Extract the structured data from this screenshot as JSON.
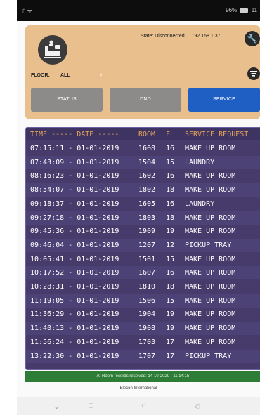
{
  "statusbar": {
    "left_icons": "▯ ᯤ",
    "battery": "96%",
    "time": "11"
  },
  "header": {
    "state_label": "State: Disconnected",
    "ip": "192.168.1.37",
    "floor_label": "FLOOR:",
    "floor_value": "ALL",
    "floor_caret": "▾"
  },
  "buttons": {
    "status": "STATUS",
    "dnd": "DND",
    "service": "SERVICE"
  },
  "colors": {
    "panel": "#e8bf8d",
    "active_button": "#1f5fc4",
    "inactive_button": "#8c8b8a",
    "table_bg": "#463b6a",
    "header_text": "#e8a25a",
    "footer_green": "#2d7d37"
  },
  "icons": {
    "logo": "hotel-room-icon",
    "settings": "wrench-icon",
    "filter": "filter-icon",
    "nav_back": "triangle-back-icon",
    "nav_home": "circle-home-icon",
    "nav_recent": "square-recent-icon",
    "nav_down": "chevron-down-icon"
  },
  "table": {
    "headers": {
      "time_date": "TIME ----- DATE -----",
      "room": "ROOM",
      "fl": "FL",
      "request": "SERVICE REQUEST"
    },
    "rows": [
      {
        "time_date": "07:15:11 - 01-01-2019",
        "room": "1608",
        "fl": "16",
        "request": "MAKE UP ROOM"
      },
      {
        "time_date": "07:43:09 - 01-01-2019",
        "room": "1504",
        "fl": "15",
        "request": "LAUNDRY"
      },
      {
        "time_date": "08:16:23 - 01-01-2019",
        "room": "1602",
        "fl": "16",
        "request": "MAKE UP ROOM"
      },
      {
        "time_date": "08:54:07 - 01-01-2019",
        "room": "1802",
        "fl": "18",
        "request": "MAKE UP ROOM"
      },
      {
        "time_date": "09:18:37 - 01-01-2019",
        "room": "1605",
        "fl": "16",
        "request": "LAUNDRY"
      },
      {
        "time_date": "09:27:18 - 01-01-2019",
        "room": "1803",
        "fl": "18",
        "request": "MAKE UP ROOM"
      },
      {
        "time_date": "09:45:36 - 01-01-2019",
        "room": "1909",
        "fl": "19",
        "request": "MAKE UP ROOM"
      },
      {
        "time_date": "09:46:04 - 01-01-2019",
        "room": "1207",
        "fl": "12",
        "request": "PICKUP TRAY"
      },
      {
        "time_date": "10:05:41 - 01-01-2019",
        "room": "1501",
        "fl": "15",
        "request": "MAKE UP ROOM"
      },
      {
        "time_date": "10:17:52 - 01-01-2019",
        "room": "1607",
        "fl": "16",
        "request": "MAKE UP ROOM"
      },
      {
        "time_date": "10:28:31 - 01-01-2019",
        "room": "1810",
        "fl": "18",
        "request": "MAKE UP ROOM"
      },
      {
        "time_date": "11:19:05 - 01-01-2019",
        "room": "1506",
        "fl": "15",
        "request": "MAKE UP ROOM"
      },
      {
        "time_date": "11:36:29 - 01-01-2019",
        "room": "1904",
        "fl": "19",
        "request": "MAKE UP ROOM"
      },
      {
        "time_date": "11:40:13 - 01-01-2019",
        "room": "1908",
        "fl": "19",
        "request": "MAKE UP ROOM"
      },
      {
        "time_date": "11:56:24 - 01-01-2019",
        "room": "1703",
        "fl": "17",
        "request": "MAKE UP ROOM"
      },
      {
        "time_date": "13:22:30 - 01-01-2019",
        "room": "1707",
        "fl": "17",
        "request": "PICKUP TRAY"
      }
    ]
  },
  "footer": {
    "records": "70 Room records received: 14-10-2020 - 11:14:15",
    "company": "Elecon International"
  },
  "navbar": {
    "down": "⌄",
    "recent": "□",
    "home": "○",
    "back": "◁"
  }
}
